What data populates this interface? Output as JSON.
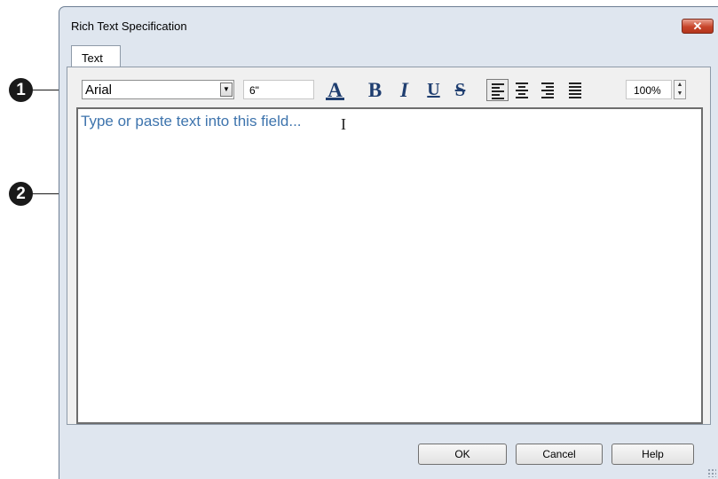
{
  "callouts": [
    "1",
    "2"
  ],
  "dialog": {
    "title": "Rich Text Specification",
    "close_label": "✕",
    "tabs": [
      {
        "label": "Text"
      }
    ]
  },
  "toolbar": {
    "font_name": "Arial",
    "font_size": "6\"",
    "buttons": [
      {
        "name": "text-color",
        "glyph": "A"
      },
      {
        "name": "bold",
        "glyph": "B"
      },
      {
        "name": "italic",
        "glyph": "I"
      },
      {
        "name": "underline",
        "glyph": "U"
      },
      {
        "name": "strikethrough",
        "glyph": "S"
      }
    ],
    "align_left_pressed": true,
    "line_spacing": "100%"
  },
  "editor": {
    "placeholder": "Type or paste text into this field...",
    "cursor": "I"
  },
  "footer": {
    "ok_label": "OK",
    "cancel_label": "Cancel",
    "help_label": "Help"
  },
  "colors": {
    "accent": "#1f3e70",
    "placeholder_text": "#3e74ad",
    "close_button": "#c8452a"
  }
}
